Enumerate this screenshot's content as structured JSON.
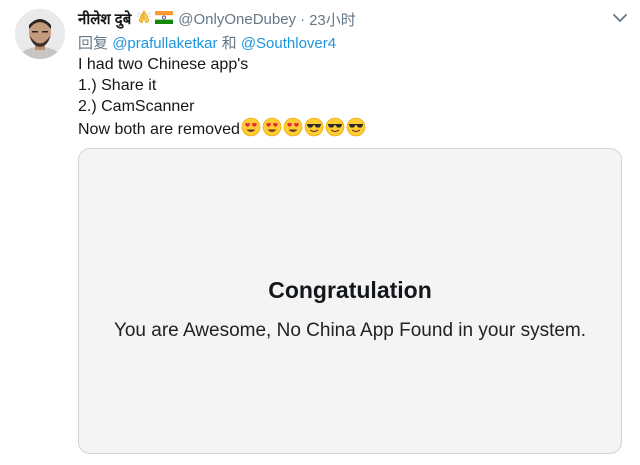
{
  "tweet": {
    "author_name": "नीलेश दुबे",
    "flair_icons": [
      "folded-hands-icon",
      "india-flag-icon"
    ],
    "handle": "@OnlyOneDubey",
    "separator": "·",
    "timestamp": "23小时",
    "reply_prefix": "回复",
    "reply_mention_1": "@prafullaketkar",
    "reply_conjunction": "和",
    "reply_mention_2": "@Southlover4",
    "lines": [
      "I had two Chinese app's",
      "1.) Share it",
      "2.) CamScanner",
      "Now both are removed"
    ],
    "emojis": [
      "heart-eyes-emoji",
      "heart-eyes-emoji",
      "heart-eyes-emoji",
      "sunglasses-emoji",
      "sunglasses-emoji",
      "sunglasses-emoji"
    ],
    "card": {
      "title": "Congratulation",
      "subtitle": "You are Awesome, No China App Found in your system."
    }
  },
  "colors": {
    "text": "#14171a",
    "secondary": "#657786",
    "link": "#1b95e0",
    "card_bg": "#f4f4f5",
    "card_border": "#cfd5da"
  }
}
